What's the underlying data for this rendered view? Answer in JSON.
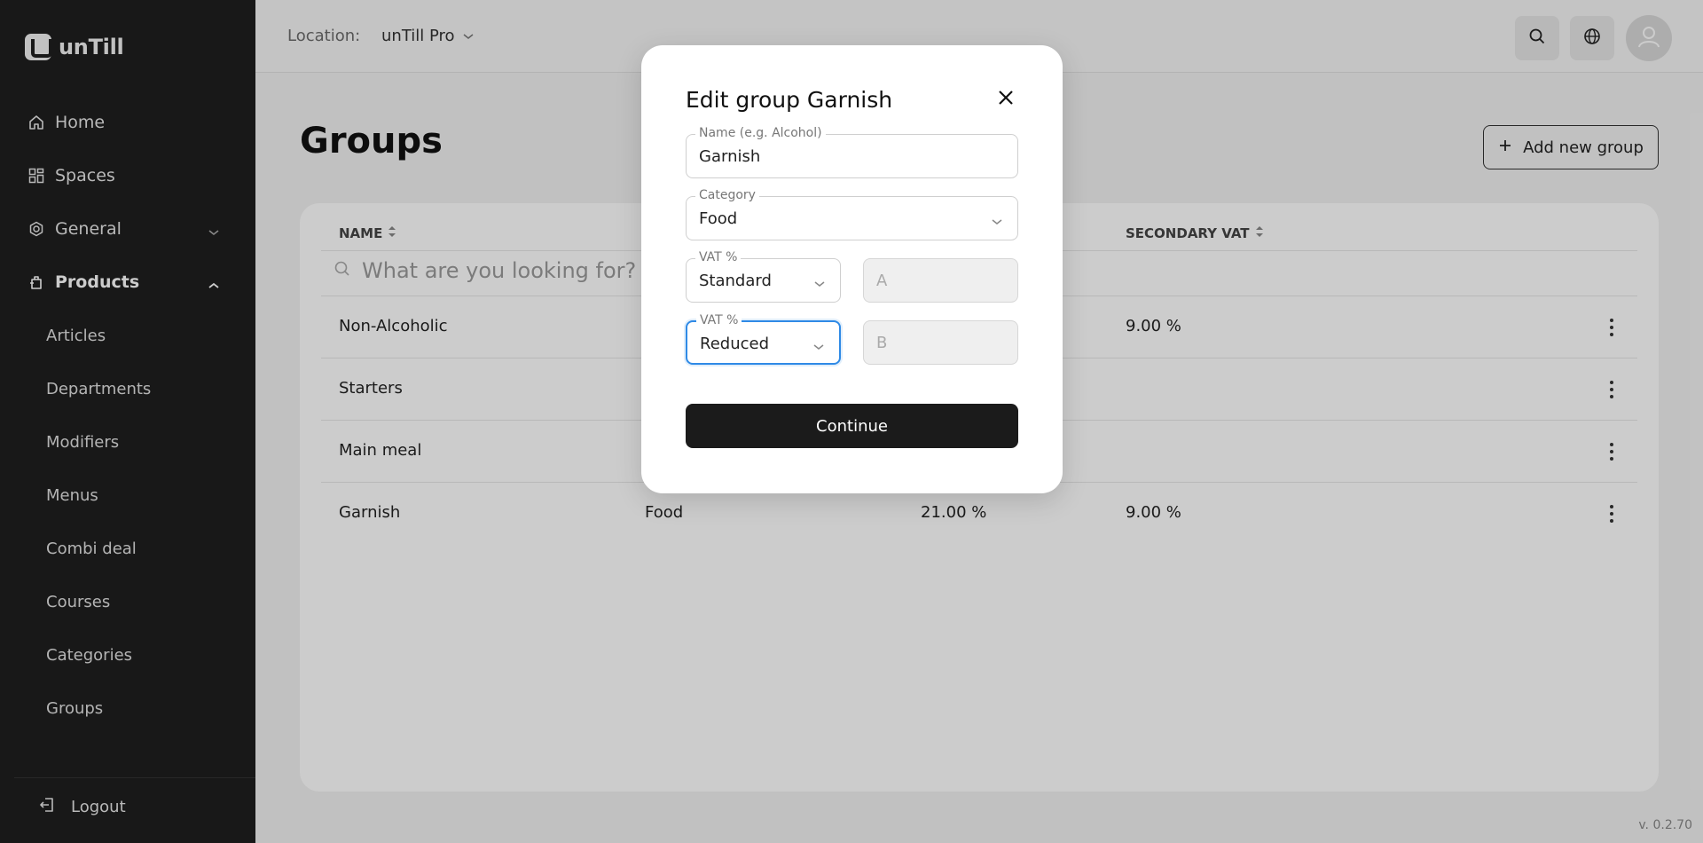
{
  "brand": {
    "name": "unTill"
  },
  "sidebar": {
    "items": [
      {
        "label": "Home"
      },
      {
        "label": "Spaces"
      },
      {
        "label": "General"
      },
      {
        "label": "Products"
      }
    ],
    "sub_items": [
      {
        "label": "Articles"
      },
      {
        "label": "Departments"
      },
      {
        "label": "Modifiers"
      },
      {
        "label": "Menus"
      },
      {
        "label": "Combi deal"
      },
      {
        "label": "Courses"
      },
      {
        "label": "Categories"
      },
      {
        "label": "Groups"
      }
    ],
    "logout_label": "Logout"
  },
  "header": {
    "location_label": "Location:",
    "location_value": "unTill Pro"
  },
  "main": {
    "title": "Groups",
    "add_button_label": "Add new group",
    "columns": [
      "NAME",
      "SECONDARY VAT"
    ],
    "search_placeholder": "What are you looking for?",
    "rows": [
      {
        "name": "Non-Alcoholic",
        "category": "",
        "vat": "",
        "secondary_vat": "9.00 %"
      },
      {
        "name": "Starters",
        "category": "",
        "vat": "",
        "secondary_vat": ""
      },
      {
        "name": "Main meal",
        "category": "",
        "vat": "",
        "secondary_vat": ""
      },
      {
        "name": "Garnish",
        "category": "Food",
        "vat": "21.00 %",
        "secondary_vat": "9.00 %"
      }
    ]
  },
  "modal": {
    "title": "Edit group Garnish",
    "name_field": {
      "label": "Name (e.g. Alcohol)",
      "value": "Garnish"
    },
    "category_field": {
      "label": "Category",
      "value": "Food"
    },
    "vat_field": {
      "label": "VAT %",
      "value": "Standard",
      "code": "A"
    },
    "vat2_field": {
      "label": "VAT %",
      "value": "Reduced",
      "code": "B"
    },
    "continue_label": "Continue"
  },
  "footer": {
    "version": "v. 0.2.70"
  }
}
